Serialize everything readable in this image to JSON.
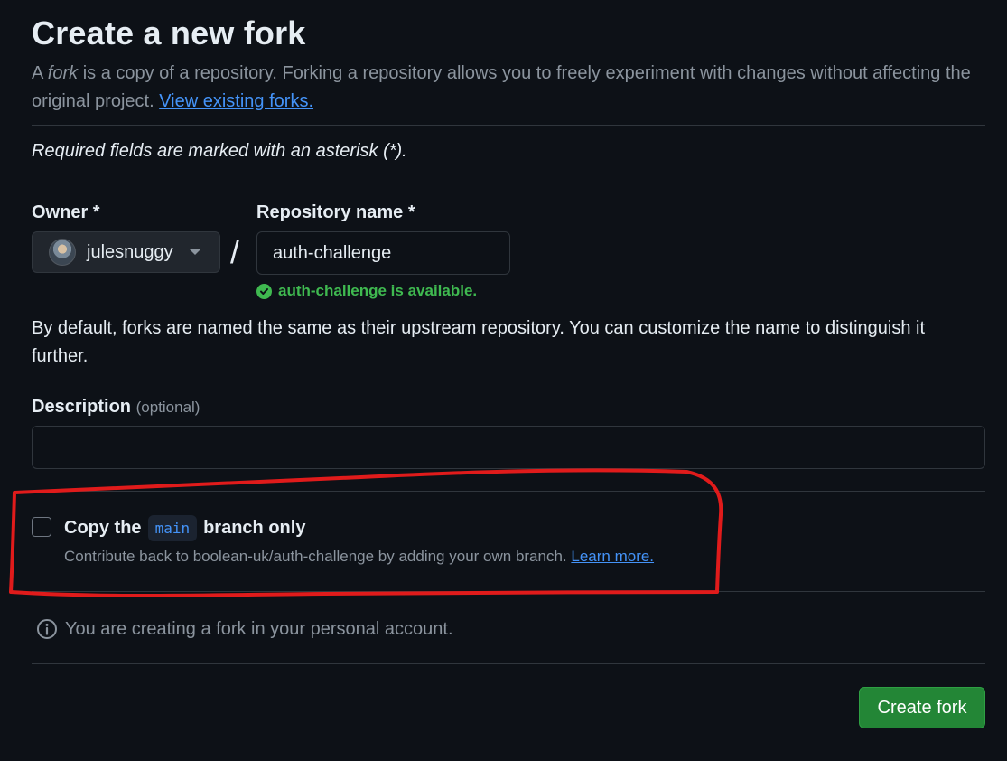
{
  "header": {
    "title": "Create a new fork",
    "subtitle_prefix": "A ",
    "subtitle_em": "fork",
    "subtitle_rest": " is a copy of a repository. Forking a repository allows you to freely experiment with changes without affecting the original project. ",
    "view_forks_link": "View existing forks."
  },
  "form": {
    "required_note": "Required fields are marked with an asterisk (*).",
    "owner_label": "Owner *",
    "owner_value": "julesnuggy",
    "separator": "/",
    "repo_label": "Repository name *",
    "repo_value": "auth-challenge",
    "availability": "auth-challenge is available.",
    "naming_help": "By default, forks are named the same as their upstream repository. You can customize the name to distinguish it further.",
    "description_label": "Description",
    "description_optional": "(optional)",
    "description_value": ""
  },
  "copy_branch": {
    "prefix": "Copy the",
    "branch": "main",
    "suffix": "branch only",
    "checked": false,
    "sub_text": "Contribute back to boolean-uk/auth-challenge by adding your own branch. ",
    "learn_more": "Learn more."
  },
  "info_text": "You are creating a fork in your personal account.",
  "create_button": "Create fork",
  "colors": {
    "background": "#0d1117",
    "accent_link": "#4493f8",
    "success": "#3fb950",
    "primary_button": "#238636",
    "annotation": "#e01b1b"
  },
  "icons": {
    "owner_avatar": "avatar",
    "owner_dropdown": "caret-down-icon",
    "availability": "check-circle-icon",
    "info": "info-icon"
  }
}
